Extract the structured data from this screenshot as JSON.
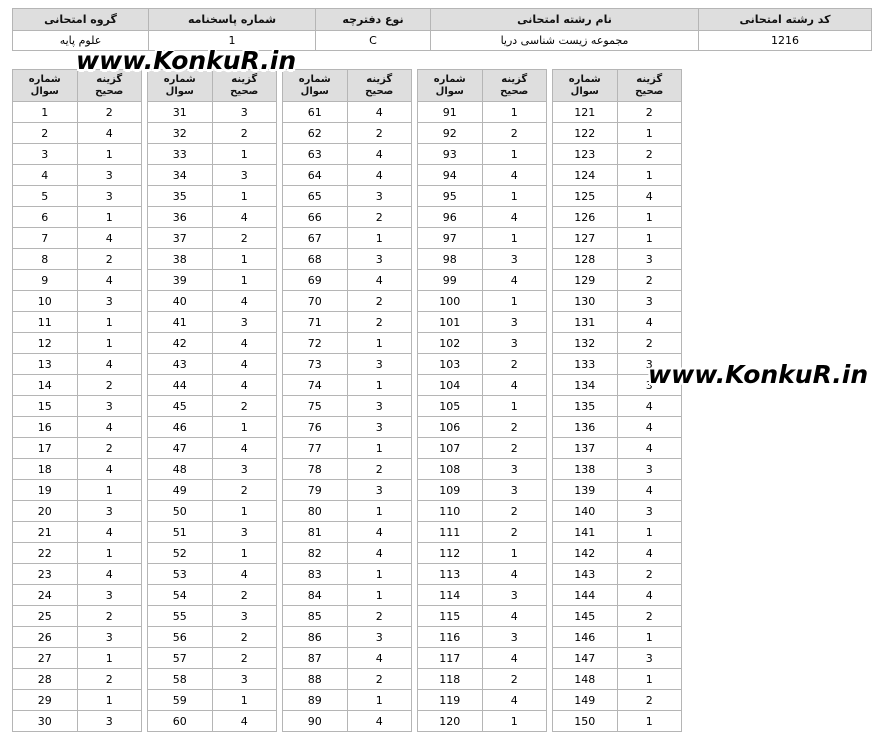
{
  "header": {
    "columns": [
      "گروه امتحانی",
      "شماره پاسخنامه",
      "نوع دفترچه",
      "نام رشته امتحانی",
      "کد رشته امتحانی"
    ],
    "values": [
      "علوم پایه",
      "1",
      "C",
      "مجموعه زیست شناسی دریا",
      "1216"
    ]
  },
  "answer_key": {
    "col_question": "شماره\nسوال",
    "col_answer": "گزینه\nصحیح",
    "blocks": [
      {
        "questions": [
          1,
          2,
          3,
          4,
          5,
          6,
          7,
          8,
          9,
          10,
          11,
          12,
          13,
          14,
          15,
          16,
          17,
          18,
          19,
          20,
          21,
          22,
          23,
          24,
          25,
          26,
          27,
          28,
          29,
          30
        ],
        "answers": [
          2,
          4,
          1,
          3,
          3,
          1,
          4,
          2,
          4,
          3,
          1,
          1,
          4,
          2,
          3,
          4,
          2,
          4,
          1,
          3,
          4,
          1,
          4,
          3,
          2,
          3,
          1,
          2,
          1,
          3
        ]
      },
      {
        "questions": [
          31,
          32,
          33,
          34,
          35,
          36,
          37,
          38,
          39,
          40,
          41,
          42,
          43,
          44,
          45,
          46,
          47,
          48,
          49,
          50,
          51,
          52,
          53,
          54,
          55,
          56,
          57,
          58,
          59,
          60
        ],
        "answers": [
          3,
          2,
          1,
          3,
          1,
          4,
          2,
          1,
          1,
          4,
          3,
          4,
          4,
          4,
          2,
          1,
          4,
          3,
          2,
          1,
          3,
          1,
          4,
          2,
          3,
          2,
          2,
          3,
          1,
          4
        ]
      },
      {
        "questions": [
          61,
          62,
          63,
          64,
          65,
          66,
          67,
          68,
          69,
          70,
          71,
          72,
          73,
          74,
          75,
          76,
          77,
          78,
          79,
          80,
          81,
          82,
          83,
          84,
          85,
          86,
          87,
          88,
          89,
          90
        ],
        "answers": [
          4,
          2,
          4,
          4,
          3,
          2,
          1,
          3,
          4,
          2,
          2,
          1,
          3,
          1,
          3,
          3,
          1,
          2,
          3,
          1,
          4,
          4,
          1,
          1,
          2,
          3,
          4,
          2,
          1,
          4
        ]
      },
      {
        "questions": [
          91,
          92,
          93,
          94,
          95,
          96,
          97,
          98,
          99,
          100,
          101,
          102,
          103,
          104,
          105,
          106,
          107,
          108,
          109,
          110,
          111,
          112,
          113,
          114,
          115,
          116,
          117,
          118,
          119,
          120
        ],
        "answers": [
          1,
          2,
          1,
          4,
          1,
          4,
          1,
          3,
          4,
          1,
          3,
          3,
          2,
          4,
          1,
          2,
          2,
          3,
          3,
          2,
          2,
          1,
          4,
          3,
          4,
          3,
          4,
          2,
          4,
          1
        ]
      },
      {
        "questions": [
          121,
          122,
          123,
          124,
          125,
          126,
          127,
          128,
          129,
          130,
          131,
          132,
          133,
          134,
          135,
          136,
          137,
          138,
          139,
          140,
          141,
          142,
          143,
          144,
          145,
          146,
          147,
          148,
          149,
          150
        ],
        "answers": [
          2,
          1,
          2,
          1,
          4,
          1,
          1,
          3,
          2,
          3,
          4,
          2,
          3,
          3,
          4,
          4,
          4,
          3,
          4,
          3,
          1,
          4,
          2,
          4,
          2,
          1,
          3,
          1,
          2,
          1
        ]
      }
    ]
  },
  "watermarks": [
    "www.KonkuR.in",
    "www.KonkuR.in"
  ]
}
